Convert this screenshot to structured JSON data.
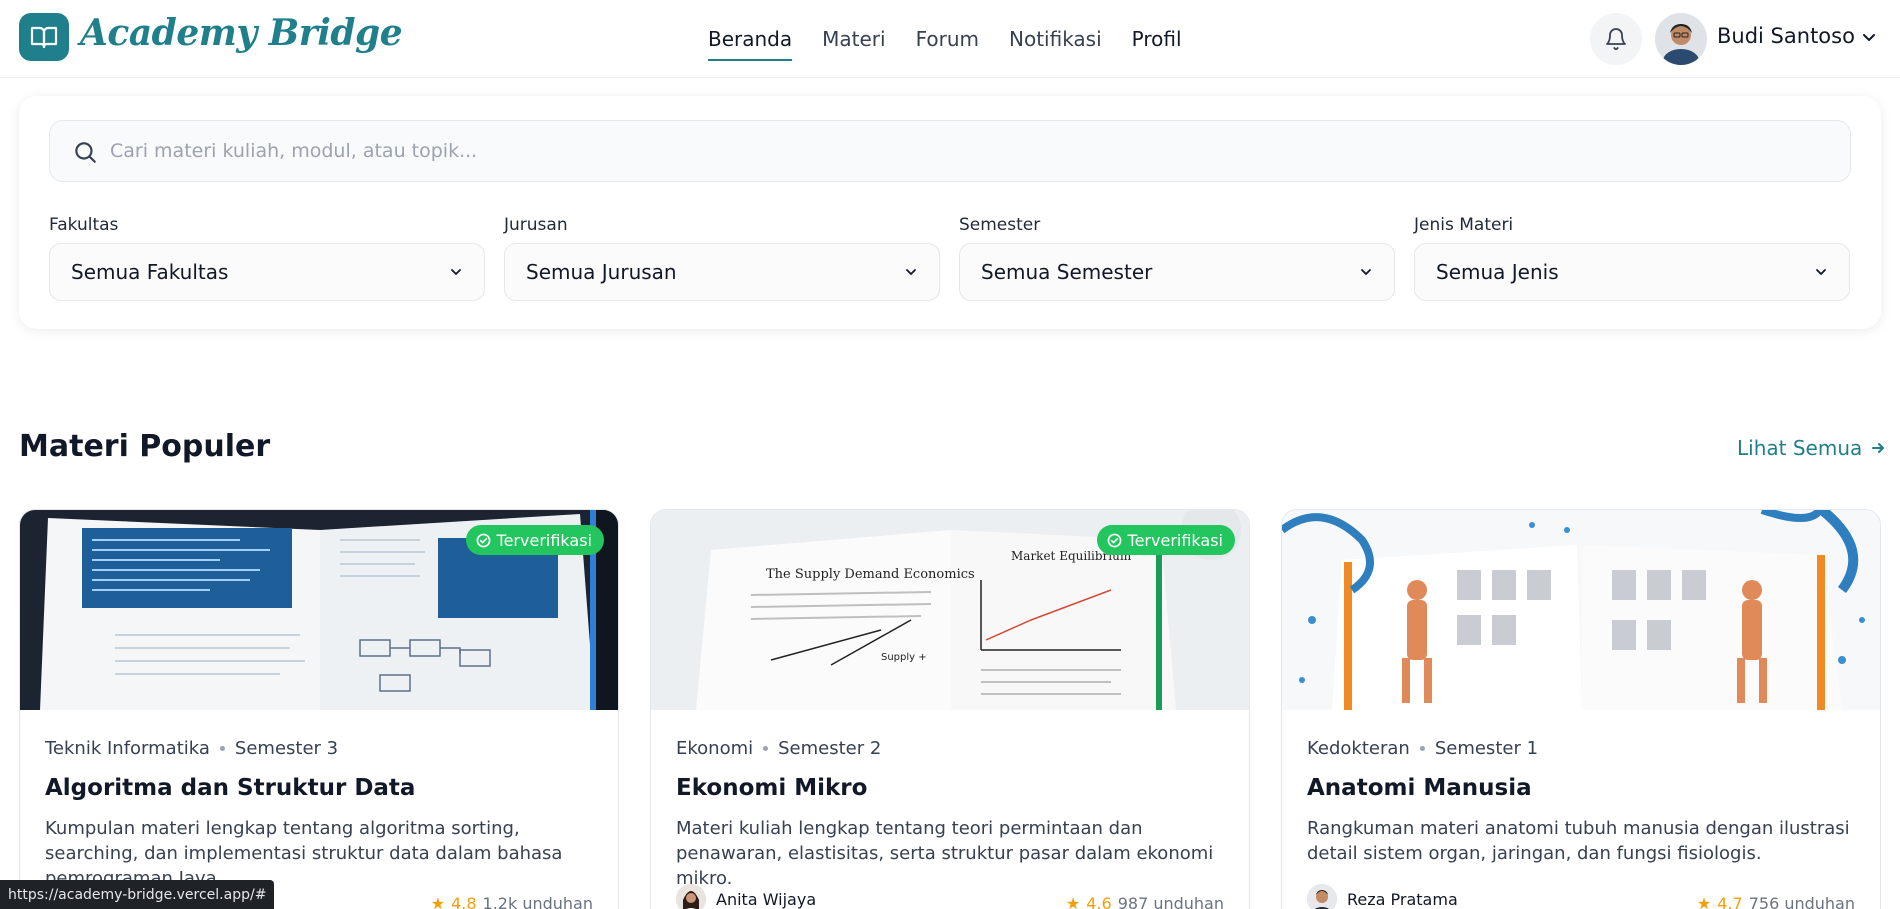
{
  "header": {
    "brand": "Academy Bridge",
    "nav": [
      "Beranda",
      "Materi",
      "Forum",
      "Notifikasi",
      "Profil"
    ],
    "active_nav": "Beranda",
    "user_name": "Budi Santoso",
    "icons": {
      "logo": "book-open-icon",
      "bell": "bell-icon",
      "chevron": "chevron-down-icon"
    }
  },
  "search": {
    "placeholder": "Cari materi kuliah, modul, atau topik...",
    "value": ""
  },
  "filters": [
    {
      "label": "Fakultas",
      "value": "Semua Fakultas"
    },
    {
      "label": "Jurusan",
      "value": "Semua Jurusan"
    },
    {
      "label": "Semester",
      "value": "Semua Semester"
    },
    {
      "label": "Jenis Materi",
      "value": "Semua Jenis"
    }
  ],
  "section": {
    "title": "Materi Populer",
    "see_all": "Lihat Semua"
  },
  "cards": [
    {
      "faculty": "Teknik Informatika",
      "semester": "Semester 3",
      "title": "Algoritma dan Struktur Data",
      "description": "Kumpulan materi lengkap tentang algoritma sorting, searching, dan implementasi struktur data dalam bahasa pemrograman Java.",
      "verified_label": "Terverifikasi",
      "author": "",
      "rating": "4.8",
      "downloads": "1.2k unduhan"
    },
    {
      "faculty": "Ekonomi",
      "semester": "Semester 2",
      "title": "Ekonomi Mikro",
      "description": "Materi kuliah lengkap tentang teori permintaan dan penawaran, elastisitas, serta struktur pasar dalam ekonomi mikro.",
      "verified_label": "Terverifikasi",
      "author": "Anita Wijaya",
      "rating": "4.6",
      "downloads": "987 unduhan"
    },
    {
      "faculty": "Kedokteran",
      "semester": "Semester 1",
      "title": "Anatomi Manusia",
      "description": "Rangkuman materi anatomi tubuh manusia dengan ilustrasi detail sistem organ, jaringan, dan fungsi fisiologis.",
      "verified_label": "",
      "author": "Reza Pratama",
      "rating": "4.7",
      "downloads": "756 unduhan"
    }
  ],
  "statusbar": {
    "url": "https://academy-bridge.vercel.app/#"
  },
  "colors": {
    "brand": "#1f7f8a",
    "verified": "#22c55e",
    "star": "#f59e0b"
  }
}
